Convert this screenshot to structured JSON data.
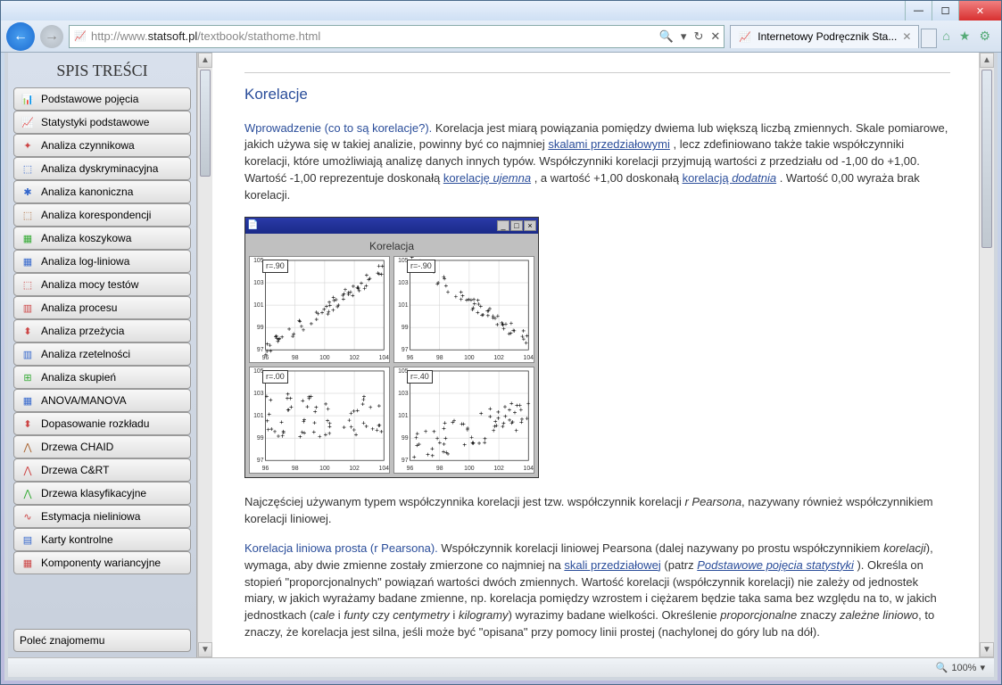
{
  "window": {
    "url_prefix": "http://",
    "url_host": "www.",
    "url_domain": "statsoft.pl",
    "url_path": "/textbook/stathome.html",
    "tab_title": "Internetowy Podręcznik Sta...",
    "zoom": "100%"
  },
  "sidebar": {
    "title": "SPIS TREŚCI",
    "items": [
      {
        "label": "Podstawowe pojęcia",
        "icon": "📊",
        "color": "#c44"
      },
      {
        "label": "Statystyki podstawowe",
        "icon": "📈",
        "color": "#c44"
      },
      {
        "label": "Analiza czynnikowa",
        "icon": "✦",
        "color": "#c44"
      },
      {
        "label": "Analiza dyskryminacyjna",
        "icon": "⬚",
        "color": "#36c"
      },
      {
        "label": "Analiza kanoniczna",
        "icon": "✱",
        "color": "#36c"
      },
      {
        "label": "Analiza korespondencji",
        "icon": "⬚",
        "color": "#a63"
      },
      {
        "label": "Analiza koszykowa",
        "icon": "▦",
        "color": "#3a3"
      },
      {
        "label": "Analiza log-liniowa",
        "icon": "▦",
        "color": "#36c"
      },
      {
        "label": "Analiza mocy testów",
        "icon": "⬚",
        "color": "#c44"
      },
      {
        "label": "Analiza procesu",
        "icon": "▥",
        "color": "#c44"
      },
      {
        "label": "Analiza przeżycia",
        "icon": "⬍",
        "color": "#c44"
      },
      {
        "label": "Analiza rzetelności",
        "icon": "▥",
        "color": "#36c"
      },
      {
        "label": "Analiza skupień",
        "icon": "⊞",
        "color": "#3a3"
      },
      {
        "label": "ANOVA/MANOVA",
        "icon": "▦",
        "color": "#36c"
      },
      {
        "label": "Dopasowanie rozkładu",
        "icon": "⬍",
        "color": "#c44"
      },
      {
        "label": "Drzewa CHAID",
        "icon": "⋀",
        "color": "#a63"
      },
      {
        "label": "Drzewa C&RT",
        "icon": "⋀",
        "color": "#c44"
      },
      {
        "label": "Drzewa klasyfikacyjne",
        "icon": "⋀",
        "color": "#3a3"
      },
      {
        "label": "Estymacja nieliniowa",
        "icon": "∿",
        "color": "#c44"
      },
      {
        "label": "Karty kontrolne",
        "icon": "▤",
        "color": "#36c"
      },
      {
        "label": "Komponenty wariancyjne",
        "icon": "▦",
        "color": "#c44"
      }
    ],
    "footer": {
      "label": "Poleć znajomemu"
    }
  },
  "article": {
    "h1": "Korelacje",
    "p1_lead": "Wprowadzenie (co to są korelacje?).",
    "p1_a": " Korelacja jest miarą powiązania pomiędzy dwiema lub większą liczbą zmiennych. Skale pomiarowe, jakich używa się w takiej analizie, powinny być co najmniej ",
    "p1_link1": "skalami przedziałowymi",
    "p1_b": " , lecz zdefiniowano także takie współczynniki korelacji, które umożliwiają analizę danych innych typów. Współczynniki korelacji przyjmują wartości z przedziału od -1,00 do +1,00. Wartość -1,00 reprezentuje doskonałą ",
    "p1_link2": "korelację ",
    "p1_link2_em": "ujemna",
    "p1_c": " , a wartość +1,00 doskonałą ",
    "p1_link3": "korelacją ",
    "p1_link3_em": "dodatnia",
    "p1_d": " . Wartość 0,00 wyraża brak korelacji.",
    "chart_title": "Korelacja",
    "p2_a": "Najczęściej używanym typem współczynnika korelacji jest tzw. współczynnik korelacji ",
    "p2_em1": "r Pearsona",
    "p2_b": ", nazywany również współczynnikiem korelacji liniowej.",
    "p3_lead": "Korelacja liniowa prosta (r Pearsona).",
    "p3_a": " Współczynnik korelacji liniowej Pearsona (dalej nazywany po prostu współczynnikiem ",
    "p3_em1": "korelacji",
    "p3_b": "), wymaga, aby dwie zmienne zostały zmierzone co najmniej na ",
    "p3_link1": "skali przedziałowej",
    "p3_c": " (patrz ",
    "p3_link2": "Podstawowe pojęcia statystyki",
    "p3_d": " ). Określa on stopień \"proporcjonalnych\" powiązań wartości dwóch zmiennych. Wartość korelacji (współczynnik korelacji) nie zależy od jednostek miary, w jakich wyrażamy badane zmienne, np. korelacja pomiędzy wzrostem i ciężarem będzie taka sama bez względu na to, w jakich jednostkach (",
    "p3_em2": "cale",
    "p3_e": " i ",
    "p3_em3": "funty",
    "p3_f": " czy ",
    "p3_em4": "centymetry",
    "p3_g": " i ",
    "p3_em5": "kilogramy",
    "p3_h": ") wyrazimy badane wielkości. Określenie ",
    "p3_em6": "proporcjonalne",
    "p3_i": " znaczy ",
    "p3_em7": "zależne liniowo",
    "p3_j": ", to znaczy, że korelacja jest silna, jeśli może być \"opisana\" przy pomocy linii prostej (nachylonej do góry lub na dół)."
  },
  "chart_data": [
    {
      "type": "scatter",
      "r_label": "r=.90",
      "xlim": [
        96,
        104
      ],
      "ylim": [
        97,
        105
      ],
      "xticks": [
        96,
        98,
        100,
        102,
        104
      ],
      "yticks": [
        97,
        99,
        101,
        103,
        105
      ],
      "trend": "positive"
    },
    {
      "type": "scatter",
      "r_label": "r=-.90",
      "xlim": [
        96,
        104
      ],
      "ylim": [
        97,
        105
      ],
      "xticks": [
        96,
        98,
        100,
        102,
        104
      ],
      "yticks": [
        97,
        99,
        101,
        103,
        105
      ],
      "trend": "negative"
    },
    {
      "type": "scatter",
      "r_label": "r=.00",
      "xlim": [
        96,
        104
      ],
      "ylim": [
        97,
        105
      ],
      "xticks": [
        96,
        98,
        100,
        102,
        104
      ],
      "yticks": [
        97,
        99,
        101,
        103,
        105
      ],
      "trend": "none"
    },
    {
      "type": "scatter",
      "r_label": "r=.40",
      "xlim": [
        96,
        104
      ],
      "ylim": [
        97,
        105
      ],
      "xticks": [
        96,
        98,
        100,
        102,
        104
      ],
      "yticks": [
        97,
        99,
        101,
        103,
        105
      ],
      "trend": "weak-positive"
    }
  ]
}
